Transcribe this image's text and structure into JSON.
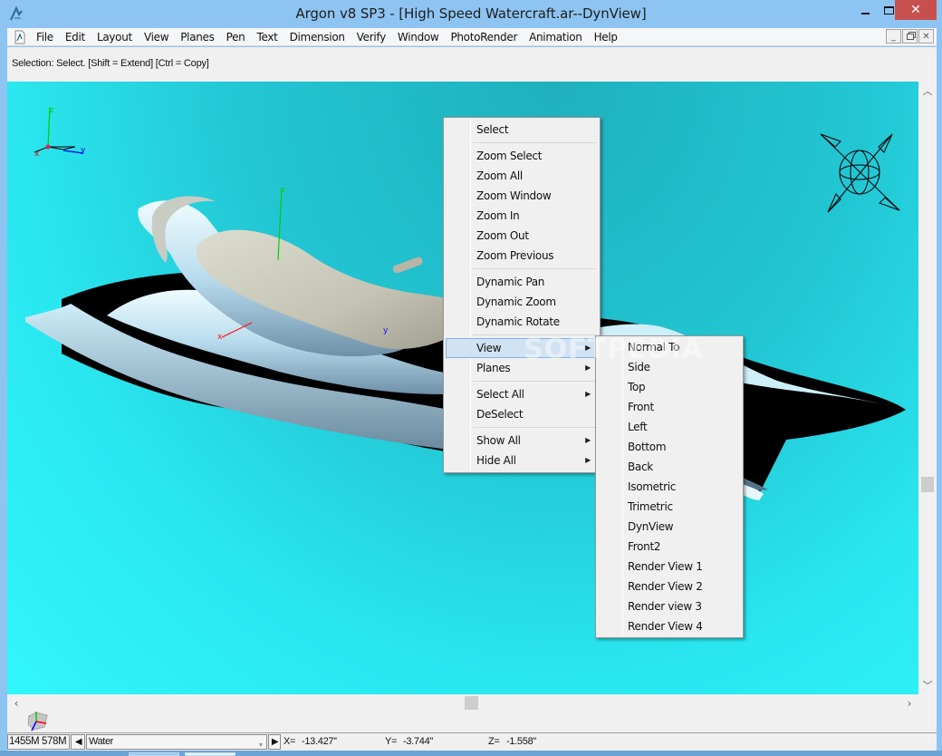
{
  "window": {
    "title": "Argon v8 SP3 - [High Speed Watercraft.ar--DynView]",
    "caption_buttons": {
      "minimize": "minimize",
      "maximize": "maximize",
      "close": "✕"
    }
  },
  "menubar": {
    "items": [
      "File",
      "Edit",
      "Layout",
      "View",
      "Planes",
      "Pen",
      "Text",
      "Dimension",
      "Verify",
      "Window",
      "PhotoRender",
      "Animation",
      "Help"
    ],
    "mdi_buttons": [
      "_",
      "🗗",
      "✕"
    ]
  },
  "prompt": {
    "text": "Selection: Select. [Shift = Extend] [Ctrl = Copy]"
  },
  "viewport": {
    "axis_triad": {
      "z": "z",
      "x": "x",
      "y": "y"
    },
    "model_axes": {
      "z": "z",
      "x": "x",
      "y": "y"
    },
    "background_color": "#2ae7f0",
    "watermark": "SOFTPEDIA"
  },
  "context_menu": {
    "groups": [
      [
        {
          "label": "Select",
          "submenu": false
        }
      ],
      [
        {
          "label": "Zoom Select",
          "submenu": false
        },
        {
          "label": "Zoom All",
          "submenu": false
        },
        {
          "label": "Zoom Window",
          "submenu": false
        },
        {
          "label": "Zoom In",
          "submenu": false
        },
        {
          "label": "Zoom Out",
          "submenu": false
        },
        {
          "label": "Zoom Previous",
          "submenu": false
        }
      ],
      [
        {
          "label": "Dynamic Pan",
          "submenu": false
        },
        {
          "label": "Dynamic Zoom",
          "submenu": false
        },
        {
          "label": "Dynamic Rotate",
          "submenu": false
        }
      ],
      [
        {
          "label": "View",
          "submenu": true,
          "highlighted": true
        },
        {
          "label": "Planes",
          "submenu": true
        }
      ],
      [
        {
          "label": "Select All",
          "submenu": true
        },
        {
          "label": "DeSelect",
          "submenu": false
        }
      ],
      [
        {
          "label": "Show All",
          "submenu": true
        },
        {
          "label": "Hide All",
          "submenu": true
        }
      ]
    ]
  },
  "view_submenu": {
    "items": [
      "Normal To",
      "Side",
      "Top",
      "Front",
      "Left",
      "Bottom",
      "Back",
      "Isometric",
      "Trimetric",
      "DynView",
      "Front2",
      "Render View 1",
      "Render View 2",
      "Render view 3",
      "Render View 4"
    ]
  },
  "statusbar": {
    "memory": "1455M  578M",
    "layer": "Water",
    "x_label": "X=",
    "x_value": "-13.427''",
    "y_label": "Y=",
    "y_value": "-3.744''",
    "z_label": "Z=",
    "z_value": "-1.558''"
  },
  "colors": {
    "titlebar": "#8ec4f2",
    "close_button": "#c7504f",
    "menu_highlight": "#d1e2f2",
    "axis_x": "#ff0000",
    "axis_y": "#0000ff",
    "axis_z": "#00cc00"
  }
}
